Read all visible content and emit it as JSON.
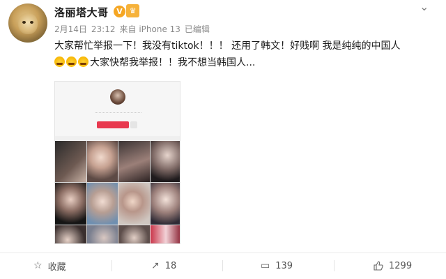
{
  "post": {
    "username": "洛丽塔大哥",
    "meta": {
      "date": "2月14日",
      "time": "23:12",
      "source": "来自 iPhone 13",
      "edited": "已编辑"
    },
    "text_line1": "大家帮忙举报一下！我没有tiktok！！！ 还用了韩文！好贱啊 我是纯纯的中国人",
    "text_line2": "大家快帮我举报！！我不想当韩国人...",
    "emojis": [
      "crying-emoji",
      "crying-emoji",
      "crying-emoji"
    ]
  },
  "actions": {
    "favorite_label": "收藏",
    "repost_count": "18",
    "comment_count": "139",
    "like_count": "1299"
  },
  "colors": {
    "accent_orange": "#f5a623",
    "tiktok_red": "#e8394f",
    "meta_gray": "#8a8a8a"
  }
}
